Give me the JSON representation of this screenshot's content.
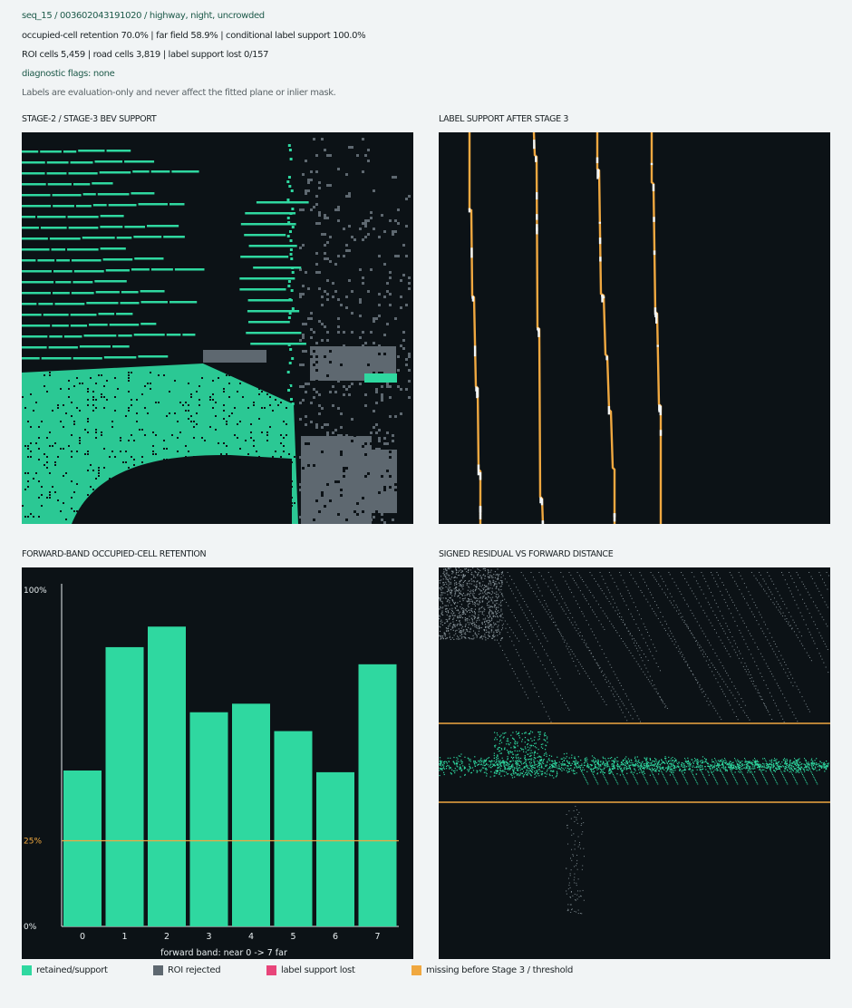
{
  "header": {
    "sequence_line": "seq_15 / 003602043191020 / highway, night, uncrowded",
    "retention_line": "occupied-cell retention 70.0% | far field 58.9% | conditional label support 100.0%",
    "cells_line": "ROI cells 5,459 | road cells 3,819 | label support lost 0/157",
    "flags_line": "diagnostic flags: none",
    "note_line": "Labels are evaluation-only and never affect the fitted plane or inlier mask."
  },
  "panels": {
    "bev_title": "STAGE-2 / STAGE-3 BEV SUPPORT",
    "label_title": "LABEL SUPPORT AFTER STAGE 3",
    "retention_title": "FORWARD-BAND OCCUPIED-CELL RETENTION",
    "residual_title": "SIGNED RESIDUAL VS FORWARD DISTANCE"
  },
  "colors": {
    "retained": "#2fd8a0",
    "rejected": "#5e6870",
    "lost": "#e8457a",
    "missing": "#f0a840",
    "panel_bg": "#0c1216"
  },
  "chart_data": [
    {
      "type": "bar",
      "title": "FORWARD-BAND OCCUPIED-CELL RETENTION",
      "categories": [
        "0",
        "1",
        "2",
        "3",
        "4",
        "5",
        "6",
        "7"
      ],
      "values": [
        45.5,
        81.5,
        87.5,
        62.5,
        65,
        57,
        45,
        76.5
      ],
      "ylim": [
        0,
        100
      ],
      "ytick_labels": [
        "0%",
        "25%",
        "100%"
      ],
      "threshold": 25,
      "threshold_label": "25%",
      "xlabel": "forward band: near 0 -> 7 far",
      "ylabel": "",
      "grid": false
    },
    {
      "type": "scatter",
      "title": "SIGNED RESIDUAL VS FORWARD DISTANCE",
      "threshold_band": [
        -1,
        1
      ],
      "xlabel": "",
      "ylabel": ""
    },
    {
      "type": "heatmap",
      "title": "STAGE-2 / STAGE-3 BEV SUPPORT"
    },
    {
      "type": "line",
      "title": "LABEL SUPPORT AFTER STAGE 3",
      "lanes": 4
    }
  ],
  "legend": [
    {
      "label": "retained/support",
      "color": "#2fd8a0"
    },
    {
      "label": "ROI rejected",
      "color": "#5e6870"
    },
    {
      "label": "label support lost",
      "color": "#e8457a"
    },
    {
      "label": "missing before Stage 3 / threshold",
      "color": "#f0a840"
    }
  ]
}
